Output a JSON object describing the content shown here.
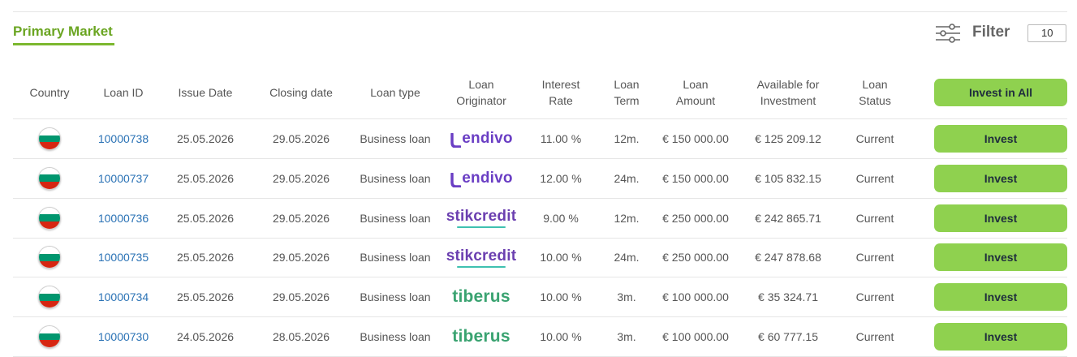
{
  "title": "Primary Market",
  "filter": {
    "label": "Filter",
    "page_size": "10",
    "icon": "sliders-icon"
  },
  "columns": {
    "country": "Country",
    "loan_id": "Loan ID",
    "issue_date": "Issue Date",
    "closing_date": "Closing date",
    "loan_type": "Loan type",
    "originator_1": "Loan",
    "originator_2": "Originator",
    "rate_1": "Interest",
    "rate_2": "Rate",
    "term_1": "Loan",
    "term_2": "Term",
    "amount_1": "Loan",
    "amount_2": "Amount",
    "avail_1": "Available for",
    "avail_2": "Investment",
    "status_1": "Loan",
    "status_2": "Status"
  },
  "invest_all_label": "Invest in All",
  "invest_label": "Invest",
  "flag_colors": [
    "#ffffff",
    "#00966e",
    "#d62612"
  ],
  "originator_colors": {
    "lendivo": "#6a3ec4",
    "stikcredit": "#6b3fb0",
    "tiberus": "#3aa371"
  },
  "accent_color": "#8fd14f",
  "rows": [
    {
      "country_flag": "bulgaria-flag",
      "loan_id": "10000738",
      "issue_date": "25.05.2026",
      "closing_date": "29.05.2026",
      "loan_type": "Business loan",
      "originator": "lendivo",
      "originator_text": "endivo",
      "rate": "11.00 %",
      "term": "12m.",
      "amount": "€ 150 000.00",
      "available": "€ 125 209.12",
      "status": "Current"
    },
    {
      "country_flag": "bulgaria-flag",
      "loan_id": "10000737",
      "issue_date": "25.05.2026",
      "closing_date": "29.05.2026",
      "loan_type": "Business loan",
      "originator": "lendivo",
      "originator_text": "endivo",
      "rate": "12.00 %",
      "term": "24m.",
      "amount": "€ 150 000.00",
      "available": "€ 105 832.15",
      "status": "Current"
    },
    {
      "country_flag": "bulgaria-flag",
      "loan_id": "10000736",
      "issue_date": "25.05.2026",
      "closing_date": "29.05.2026",
      "loan_type": "Business loan",
      "originator": "stikcredit",
      "originator_text": "stikcredit",
      "rate": "9.00 %",
      "term": "12m.",
      "amount": "€ 250 000.00",
      "available": "€ 242 865.71",
      "status": "Current"
    },
    {
      "country_flag": "bulgaria-flag",
      "loan_id": "10000735",
      "issue_date": "25.05.2026",
      "closing_date": "29.05.2026",
      "loan_type": "Business loan",
      "originator": "stikcredit",
      "originator_text": "stikcredit",
      "rate": "10.00 %",
      "term": "24m.",
      "amount": "€ 250 000.00",
      "available": "€ 247 878.68",
      "status": "Current"
    },
    {
      "country_flag": "bulgaria-flag",
      "loan_id": "10000734",
      "issue_date": "25.05.2026",
      "closing_date": "29.05.2026",
      "loan_type": "Business loan",
      "originator": "tiberus",
      "originator_text": "tiberus",
      "rate": "10.00 %",
      "term": "3m.",
      "amount": "€ 100 000.00",
      "available": "€ 35 324.71",
      "status": "Current"
    },
    {
      "country_flag": "bulgaria-flag",
      "loan_id": "10000730",
      "issue_date": "24.05.2026",
      "closing_date": "28.05.2026",
      "loan_type": "Business loan",
      "originator": "tiberus",
      "originator_text": "tiberus",
      "rate": "10.00 %",
      "term": "3m.",
      "amount": "€ 100 000.00",
      "available": "€ 60 777.15",
      "status": "Current"
    }
  ]
}
